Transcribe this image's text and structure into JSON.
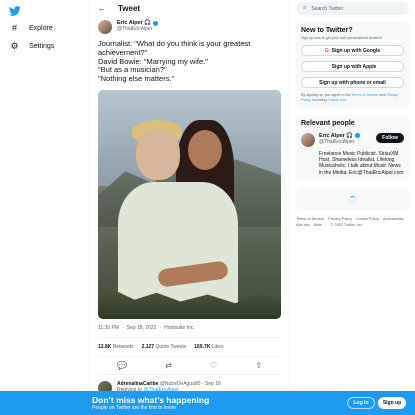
{
  "nav": {
    "logo_icon": "twitter-bird-icon",
    "items": [
      {
        "label": "Explore",
        "icon": "hashtag-icon"
      },
      {
        "label": "Settings",
        "icon": "gear-icon"
      }
    ]
  },
  "main": {
    "title": "Tweet",
    "tweet": {
      "author_name": "Eric Alper 🎧",
      "author_handle": "@ThatEricAlper",
      "text_lines": [
        "Journalist: \"What do you think is your greatest achievement?\"",
        "David Bowie: \"Marrying my wife.\"",
        "\"But as a musician?\"",
        "\"Nothing else matters.\""
      ],
      "time": "11:30 PM",
      "date": "Sep 18, 2022",
      "source": "Hootsuite Inc.",
      "stats": {
        "retweets_count": "12.8K",
        "retweets_label": "Retweets",
        "quotes_count": "2,127",
        "quotes_label": "Quote Tweets",
        "likes_count": "169.7K",
        "likes_label": "Likes"
      }
    },
    "reply": {
      "name": "AdrenalinaCaribe",
      "handle": "@NubeDeAgua80",
      "date": "Sep 18",
      "replying_prefix": "Replying to",
      "replying_to": "@ThatEricAlper"
    }
  },
  "right": {
    "search_placeholder": "Search Twitter",
    "signup_card": {
      "title": "New to Twitter?",
      "subtitle": "Sign up now to get your own personalized timeline!",
      "google_label": "Sign up with Google",
      "apple_label": "Sign up with Apple",
      "phone_label": "Sign up with phone or email",
      "legal_pre": "By signing up, you agree to the",
      "terms": "Terms of Service",
      "and": "and",
      "privacy": "Privacy Policy",
      "including": ", including",
      "cookie": "Cookie Use."
    },
    "relevant": {
      "title": "Relevant people",
      "name": "Eric Alper 🎧",
      "handle": "@ThatEricAlper",
      "follow_label": "Follow",
      "bio": "Freelance Music Publicist. SiriusXM Host. Shameless Idealist. Lifelong Musicaholic. I talk about Music News in the Media. Eric@ThatEricAlper.com"
    },
    "footer": {
      "links": [
        "Terms of Service",
        "Privacy Policy",
        "Cookie Policy",
        "Accessibility",
        "Ads info",
        "More ..."
      ],
      "copyright": "© 2022 Twitter, Inc."
    }
  },
  "bottom_bar": {
    "title": "Don’t miss what’s happening",
    "subtitle": "People on Twitter are the first to know.",
    "login_label": "Log in",
    "signup_label": "Sign up"
  },
  "colors": {
    "accent": "#1d9bf0",
    "text": "#0f1419",
    "muted": "#536471"
  }
}
